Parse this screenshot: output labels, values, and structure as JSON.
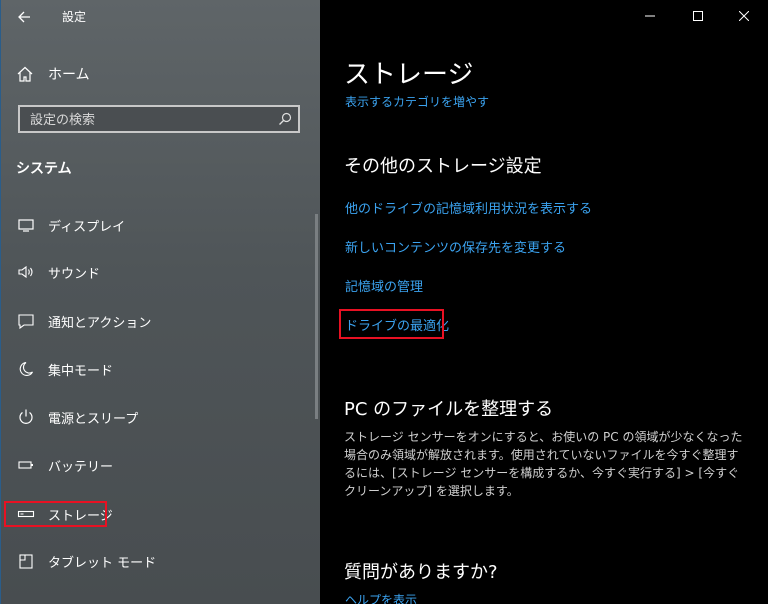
{
  "app_title": "設定",
  "sidebar": {
    "home_label": "ホーム",
    "search_placeholder": "設定の検索",
    "section_heading": "システム",
    "items": [
      {
        "label": "ディスプレイ",
        "icon": "display-icon"
      },
      {
        "label": "サウンド",
        "icon": "speaker-icon"
      },
      {
        "label": "通知とアクション",
        "icon": "notification-icon"
      },
      {
        "label": "集中モード",
        "icon": "moon-icon"
      },
      {
        "label": "電源とスリープ",
        "icon": "power-icon"
      },
      {
        "label": "バッテリー",
        "icon": "battery-icon"
      },
      {
        "label": "ストレージ",
        "icon": "storage-icon",
        "selected": true
      },
      {
        "label": "タブレット モード",
        "icon": "tablet-icon"
      }
    ]
  },
  "main": {
    "title": "ストレージ",
    "show_more_link": "表示するカテゴリを増やす",
    "other_settings_heading": "その他のストレージ設定",
    "links": [
      "他のドライブの記憶域利用状況を表示する",
      "新しいコンテンツの保存先を変更する",
      "記憶域の管理",
      "ドライブの最適化"
    ],
    "organize_heading": "PC のファイルを整理する",
    "organize_text": "ストレージ センサーをオンにすると、お使いの PC の領域が少なくなった場合のみ領域が解放されます。使用されていないファイルを今すぐ整理するには、[ストレージ センサーを構成するか、今すぐ実行する] > [今すぐクリーンアップ] を選択します。",
    "questions_heading": "質問がありますか?",
    "help_link": "ヘルプを表示"
  },
  "colors": {
    "accent_link": "#3ba3f0",
    "highlight": "#e81123",
    "sidebar_bg": "#545a5d",
    "main_bg": "#000000"
  }
}
